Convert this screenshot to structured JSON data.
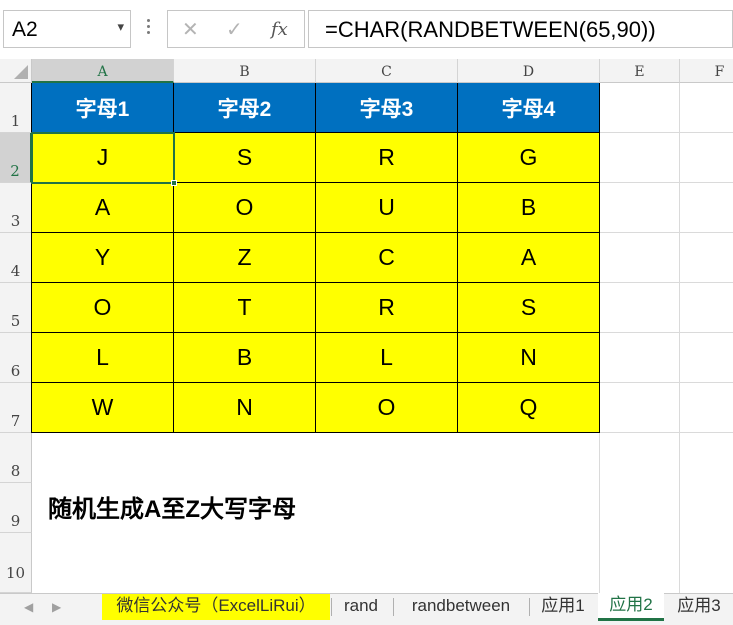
{
  "formula_bar": {
    "name_box": "A2",
    "cancel_icon": "✕",
    "enter_icon": "✓",
    "fx_label": "fx",
    "formula": "=CHAR(RANDBETWEEN(65,90))"
  },
  "columns": [
    "A",
    "B",
    "C",
    "D",
    "E",
    "F"
  ],
  "rows": [
    "1",
    "2",
    "3",
    "4",
    "5",
    "6",
    "7",
    "8",
    "9",
    "10"
  ],
  "table": {
    "headers": [
      "字母1",
      "字母2",
      "字母3",
      "字母4"
    ],
    "rows": [
      [
        "J",
        "S",
        "R",
        "G"
      ],
      [
        "A",
        "O",
        "U",
        "B"
      ],
      [
        "Y",
        "Z",
        "C",
        "A"
      ],
      [
        "O",
        "T",
        "R",
        "S"
      ],
      [
        "L",
        "B",
        "L",
        "N"
      ],
      [
        "W",
        "N",
        "O",
        "Q"
      ]
    ]
  },
  "note": "随机生成A至Z大写字母",
  "sheet_tabs": [
    {
      "label": "微信公众号（ExcelLiRui）",
      "highlight": "#ffff00"
    },
    {
      "label": "rand"
    },
    {
      "label": "randbetween"
    },
    {
      "label": "应用1"
    },
    {
      "label": "应用2",
      "active": true
    },
    {
      "label": "应用3"
    }
  ],
  "colors": {
    "header_fill": "#0070c0",
    "value_fill": "#ffff00",
    "excel_green": "#217346"
  }
}
